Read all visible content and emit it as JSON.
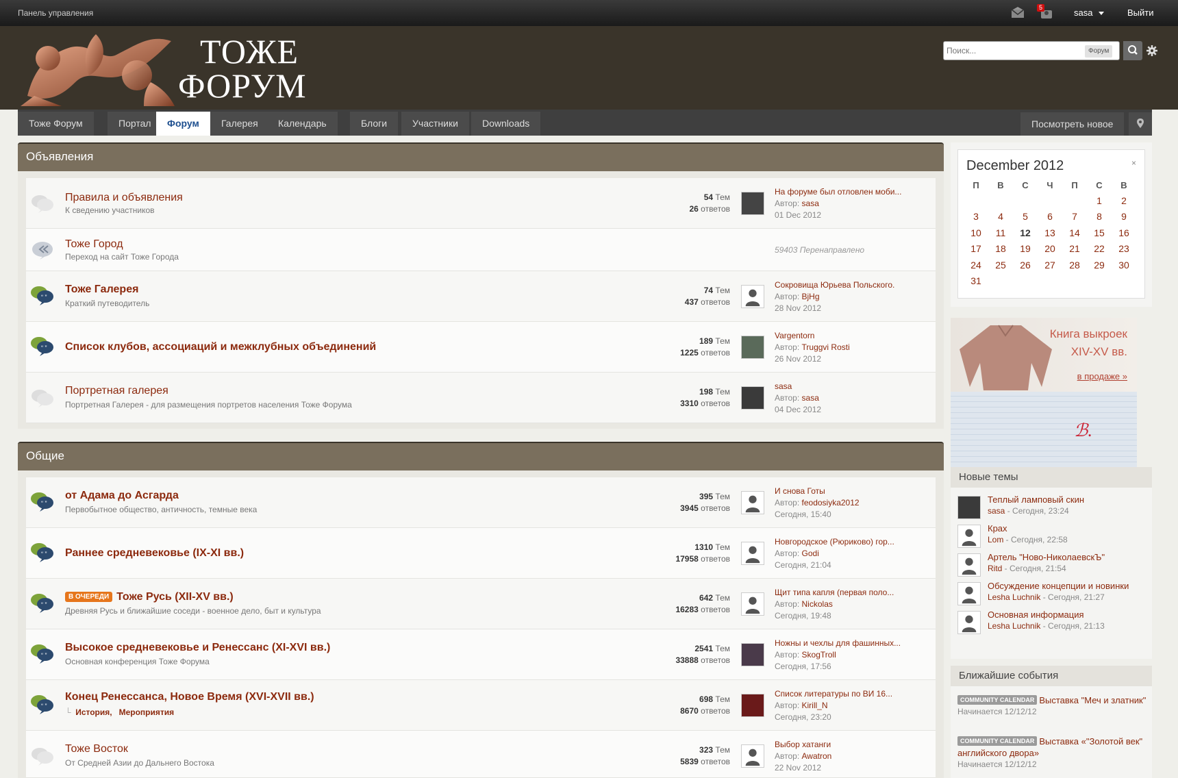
{
  "topbar": {
    "control_panel": "Панель управления",
    "notif_count": "5",
    "username": "sasa",
    "logout": "Выйти"
  },
  "header": {
    "logo_line1": "ТОЖЕ",
    "logo_line2": "ФОРУМ",
    "search_placeholder": "Поиск...",
    "search_scope": "Форум"
  },
  "nav": {
    "tabs": [
      "Тоже Форум",
      "Портал",
      "Форум",
      "Галерея",
      "Календарь",
      "Блоги",
      "Участники",
      "Downloads"
    ],
    "active": "Форум",
    "view_new": "Посмотреть новое"
  },
  "categories": [
    {
      "title": "Объявления"
    },
    {
      "title": "Общие"
    }
  ],
  "forums": [
    {
      "name": "Правила и объявления",
      "desc": "К сведению участников",
      "topics": "54",
      "topics_label": "Тем",
      "replies": "26",
      "replies_label": "ответов",
      "last_title": "На форуме был отловлен моби...",
      "author_label": "Автор:",
      "author": "sasa",
      "date": "01 Dec 2012"
    },
    {
      "name": "Тоже Город",
      "desc": "Переход на сайт Тоже Города",
      "redirect": "59403 Перенаправлено"
    },
    {
      "name": "Тоже Галерея",
      "desc": "Краткий путеводитель",
      "topics": "74",
      "topics_label": "Тем",
      "replies": "437",
      "replies_label": "ответов",
      "last_title": "Сокровища Юрьева Польского.",
      "author_label": "Автор:",
      "author": "BjHg",
      "date": "28 Nov 2012"
    },
    {
      "name": "Список клубов, ассоциаций и межклубных объединений",
      "desc": "",
      "topics": "189",
      "topics_label": "Тем",
      "replies": "1225",
      "replies_label": "ответов",
      "last_title": "Vargentorn",
      "author_label": "Автор:",
      "author": "Truggvi Rosti",
      "date": "26 Nov 2012"
    },
    {
      "name": "Портретная галерея",
      "desc": "Портретная Галерея - для размещения портретов населения Тоже Форума",
      "topics": "198",
      "topics_label": "Тем",
      "replies": "3310",
      "replies_label": "ответов",
      "last_title": "sasa",
      "author_label": "Автор:",
      "author": "sasa",
      "date": "04 Dec 2012"
    },
    {
      "name": "от Адама до Асгарда",
      "desc": "Первобытное общество, античность, темные века",
      "topics": "395",
      "topics_label": "Тем",
      "replies": "3945",
      "replies_label": "ответов",
      "last_title": "И снова Готы",
      "author_label": "Автор:",
      "author": "feodosiyka2012",
      "date": "Сегодня, 15:40"
    },
    {
      "name": "Раннее средневековье (IX-XI вв.)",
      "desc": "",
      "topics": "1310",
      "topics_label": "Тем",
      "replies": "17958",
      "replies_label": "ответов",
      "last_title": "Новгородское (Рюриково) гор...",
      "author_label": "Автор:",
      "author": "Godi",
      "date": "Сегодня, 21:04"
    },
    {
      "name": "Тоже Русь (XII-XV вв.)",
      "badge": "В ОЧЕРЕДИ",
      "desc": "Древняя Русь и ближайшие соседи - военное дело, быт и культура",
      "topics": "642",
      "topics_label": "Тем",
      "replies": "16283",
      "replies_label": "ответов",
      "last_title": "Щит типа капля (первая поло...",
      "author_label": "Автор:",
      "author": "Nickolas",
      "date": "Сегодня, 19:48"
    },
    {
      "name": "Высокое средневековье и Ренессанс (XI-XVI вв.)",
      "desc": "Основная конференция Тоже Форума",
      "topics": "2541",
      "topics_label": "Тем",
      "replies": "33888",
      "replies_label": "ответов",
      "last_title": "Ножны и чехлы для фашинных...",
      "author_label": "Автор:",
      "author": "SkogTroll",
      "date": "Сегодня, 17:56"
    },
    {
      "name": "Конец Ренессанса, Новое Время (XVI-XVII вв.)",
      "subforums": [
        "История",
        "Мероприятия"
      ],
      "topics": "698",
      "topics_label": "Тем",
      "replies": "8670",
      "replies_label": "ответов",
      "last_title": "Список литературы по ВИ 16...",
      "author_label": "Автор:",
      "author": "Kirill_N",
      "date": "Сегодня, 23:20"
    },
    {
      "name": "Тоже Восток",
      "desc": "От Средней Азии до Дальнего Востока",
      "topics": "323",
      "topics_label": "Тем",
      "replies": "5839",
      "replies_label": "ответов",
      "last_title": "Выбор хатанги",
      "author_label": "Автор:",
      "author": "Awatron",
      "date": "22 Nov 2012"
    }
  ],
  "calendar": {
    "month": "December 2012",
    "close": "×",
    "weekdays": [
      "П",
      "В",
      "С",
      "Ч",
      "П",
      "С",
      "В"
    ],
    "today": "12"
  },
  "ad": {
    "line1": "Книга выкроек",
    "line2": "XIV-XV вв.",
    "link": "в продаже »"
  },
  "new_topics": {
    "title": "Новые темы",
    "items": [
      {
        "title": "Теплый ламповый скин",
        "author": "sasa",
        "time": " - Сегодня, 23:24"
      },
      {
        "title": "Крах",
        "author": "Lom",
        "time": " - Сегодня, 22:58"
      },
      {
        "title": "Артель \"Ново-НиколаевскЪ\"",
        "author": "Ritd",
        "time": " - Сегодня, 21:54"
      },
      {
        "title": "Обсуждение концепции и новинки",
        "author": "Lesha Luchnik",
        "time": " - Сегодня, 21:27"
      },
      {
        "title": "Основная информация",
        "author": "Lesha Luchnik",
        "time": " - Сегодня, 21:13"
      }
    ]
  },
  "events": {
    "title": "Ближайшие события",
    "items": [
      {
        "tag": "COMMUNITY CALENDAR",
        "title": "Выставка \"Меч и златник\"",
        "starts": "Начинается 12/12/12"
      },
      {
        "tag": "COMMUNITY CALENDAR",
        "title": "Выставка «\"Золотой век\" английского двора»",
        "starts": "Начинается 12/12/12"
      }
    ]
  },
  "colors": {
    "accent": "#8c2a0e",
    "category_bar": "#7a6f5d",
    "header_bg": "#3a342a",
    "queue_badge": "#e6761c"
  }
}
